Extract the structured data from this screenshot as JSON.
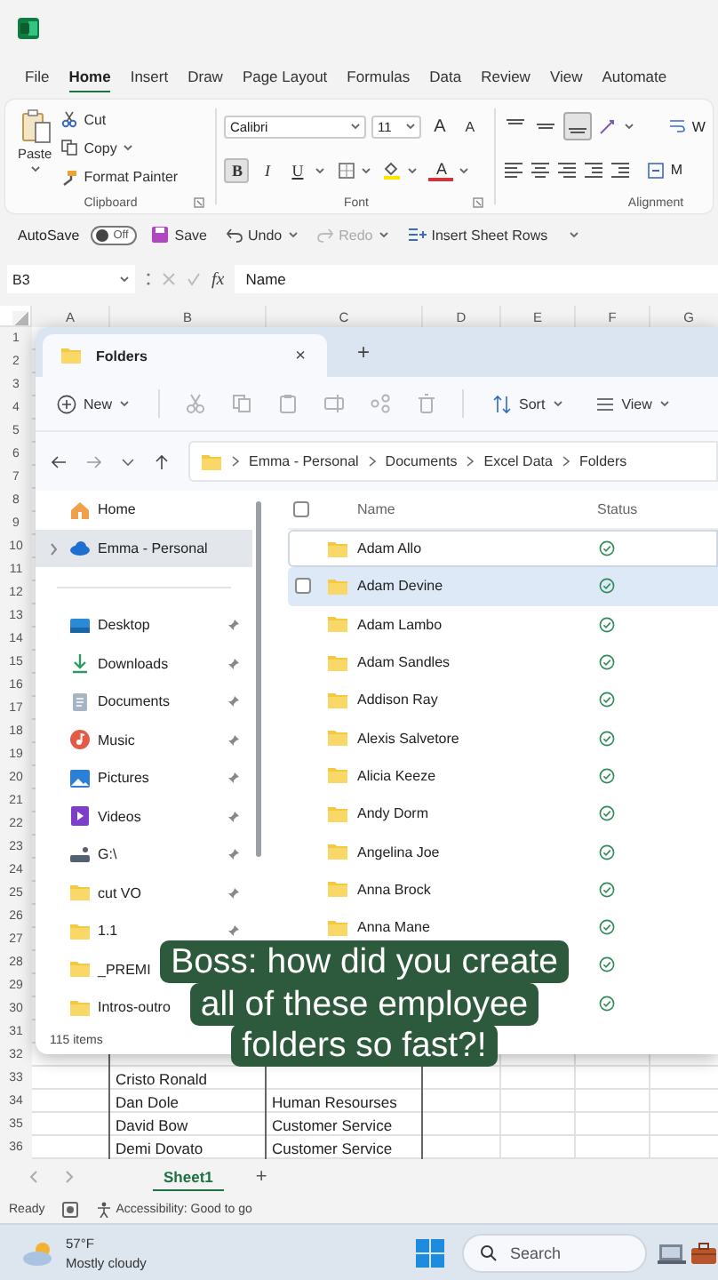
{
  "excel": {
    "menu_tabs": [
      {
        "label": "File",
        "selected": false
      },
      {
        "label": "Home",
        "selected": true
      },
      {
        "label": "Insert",
        "selected": false
      },
      {
        "label": "Draw",
        "selected": false
      },
      {
        "label": "Page Layout",
        "selected": false
      },
      {
        "label": "Formulas",
        "selected": false
      },
      {
        "label": "Data",
        "selected": false
      },
      {
        "label": "Review",
        "selected": false
      },
      {
        "label": "View",
        "selected": false
      },
      {
        "label": "Automate",
        "selected": false
      }
    ],
    "clipboard": {
      "paste": "Paste",
      "cut": "Cut",
      "copy": "Copy",
      "format_painter": "Format Painter",
      "label": "Clipboard"
    },
    "font": {
      "name": "Calibri",
      "size": "11",
      "grow": "A",
      "shrink": "A",
      "styles": [
        {
          "label": "B",
          "selected": true
        },
        {
          "label": "I",
          "selected": false
        },
        {
          "label": "U",
          "selected": false
        }
      ],
      "color_label": "A",
      "label": "Font"
    },
    "alignment": {
      "vertical": [
        {
          "kind": "top",
          "selected": false
        },
        {
          "kind": "middle",
          "selected": false
        },
        {
          "kind": "bottom",
          "selected": true
        }
      ],
      "wrap": "W",
      "merge": "M",
      "label": "Alignment"
    },
    "quick_access": {
      "autosave": "AutoSave",
      "autosave_on": false,
      "autosave_state": "Off",
      "save": "Save",
      "undo": "Undo",
      "redo": "Redo",
      "redo_disabled": true,
      "insert_rows": "Insert Sheet Rows"
    },
    "formula_bar": {
      "cell": "B3",
      "function_label": "fx",
      "value": "Name"
    },
    "columns": [
      "A",
      "B",
      "C",
      "D",
      "E",
      "F",
      "G"
    ],
    "rows": [
      {
        "number": "1"
      },
      {
        "number": "2"
      },
      {
        "number": "3"
      },
      {
        "number": "4"
      },
      {
        "number": "5"
      },
      {
        "number": "6"
      },
      {
        "number": "7"
      },
      {
        "number": "8"
      },
      {
        "number": "9"
      },
      {
        "number": "10"
      },
      {
        "number": "11"
      },
      {
        "number": "12"
      },
      {
        "number": "13"
      },
      {
        "number": "14"
      },
      {
        "number": "15"
      },
      {
        "number": "16"
      },
      {
        "number": "17"
      },
      {
        "number": "18"
      },
      {
        "number": "19"
      },
      {
        "number": "20"
      },
      {
        "number": "21"
      },
      {
        "number": "22"
      },
      {
        "number": "23"
      },
      {
        "number": "24"
      },
      {
        "number": "25"
      },
      {
        "number": "26"
      },
      {
        "number": "27"
      },
      {
        "number": "28"
      },
      {
        "number": "29"
      },
      {
        "number": "30"
      },
      {
        "number": "31"
      },
      {
        "number": "32"
      },
      {
        "number": "33",
        "column_b": "Cristo Ronald"
      },
      {
        "number": "34",
        "column_b": "Dan Dole",
        "column_c": "Human Resourses"
      },
      {
        "number": "35",
        "column_b": "David Bow",
        "column_c": "Customer Service"
      },
      {
        "number": "36",
        "column_b": "Demi Dovato",
        "column_c": "Customer Service"
      }
    ],
    "sheet_tabs": [
      {
        "label": "Sheet1",
        "selected": true
      }
    ],
    "new_sheet": "+",
    "status": {
      "ready": "Ready",
      "accessibility": "Accessibility: Good to go"
    }
  },
  "explorer": {
    "tab": {
      "title": "Folders",
      "close": "×"
    },
    "new_tab": "+",
    "toolbar": {
      "new": "New",
      "sort": "Sort",
      "view": "View"
    },
    "breadcrumb": [
      "Emma - Personal",
      "Documents",
      "Excel Data",
      "Folders"
    ],
    "nav": {
      "top": [
        {
          "label": "Home",
          "kind": "home",
          "selected": false
        },
        {
          "label": "Emma - Personal",
          "kind": "cloud",
          "selected": true,
          "expanded": false
        }
      ],
      "quick_access": [
        {
          "label": "Desktop",
          "kind": "desktop",
          "selected": false,
          "pinned": true
        },
        {
          "label": "Downloads",
          "kind": "downloads",
          "selected": false,
          "pinned": true
        },
        {
          "label": "Documents",
          "kind": "documents",
          "selected": false,
          "pinned": true
        },
        {
          "label": "Music",
          "kind": "music",
          "selected": false,
          "pinned": true
        },
        {
          "label": "Pictures",
          "kind": "pictures",
          "selected": false,
          "pinned": true
        },
        {
          "label": "Videos",
          "kind": "videos",
          "selected": false,
          "pinned": true
        },
        {
          "label": "G:\\",
          "kind": "drive",
          "selected": false,
          "pinned": true
        },
        {
          "label": "cut VO",
          "kind": "folder",
          "selected": false,
          "pinned": true
        },
        {
          "label": "1.1",
          "kind": "folder",
          "selected": false,
          "pinned": true
        },
        {
          "label": "_PREMI",
          "kind": "folder",
          "selected": false
        },
        {
          "label": "Intros-outro",
          "kind": "folder",
          "selected": false
        }
      ]
    },
    "item_count": "115 items",
    "select_all_checked": false,
    "columns": [
      "Name",
      "Status"
    ],
    "files": [
      {
        "name": "Adam Allo",
        "selected": false,
        "focused": true,
        "kind": "synced"
      },
      {
        "name": "Adam Devine",
        "selected": true,
        "focused": false,
        "kind": "synced"
      },
      {
        "name": "Adam Lambo",
        "selected": false,
        "focused": false,
        "kind": "synced"
      },
      {
        "name": "Adam Sandles",
        "selected": false,
        "focused": false,
        "kind": "synced"
      },
      {
        "name": "Addison Ray",
        "selected": false,
        "focused": false,
        "kind": "synced"
      },
      {
        "name": "Alexis Salvetore",
        "selected": false,
        "focused": false,
        "kind": "synced"
      },
      {
        "name": "Alicia Keeze",
        "selected": false,
        "focused": false,
        "kind": "synced"
      },
      {
        "name": "Andy Dorm",
        "selected": false,
        "focused": false,
        "kind": "synced"
      },
      {
        "name": "Angelina Joe",
        "selected": false,
        "focused": false,
        "kind": "synced"
      },
      {
        "name": "Anna Brock",
        "selected": false,
        "focused": false,
        "kind": "synced"
      },
      {
        "name": "Anna Mane",
        "selected": false,
        "focused": false,
        "kind": "synced"
      },
      {
        "kind": "synced"
      },
      {
        "kind": "synced"
      }
    ]
  },
  "caption": "Boss: how did you create\nall of these employee\nfolders so fast?!",
  "taskbar": {
    "temperature": "57°F",
    "weather": "Mostly cloudy",
    "search_placeholder": "Search"
  }
}
